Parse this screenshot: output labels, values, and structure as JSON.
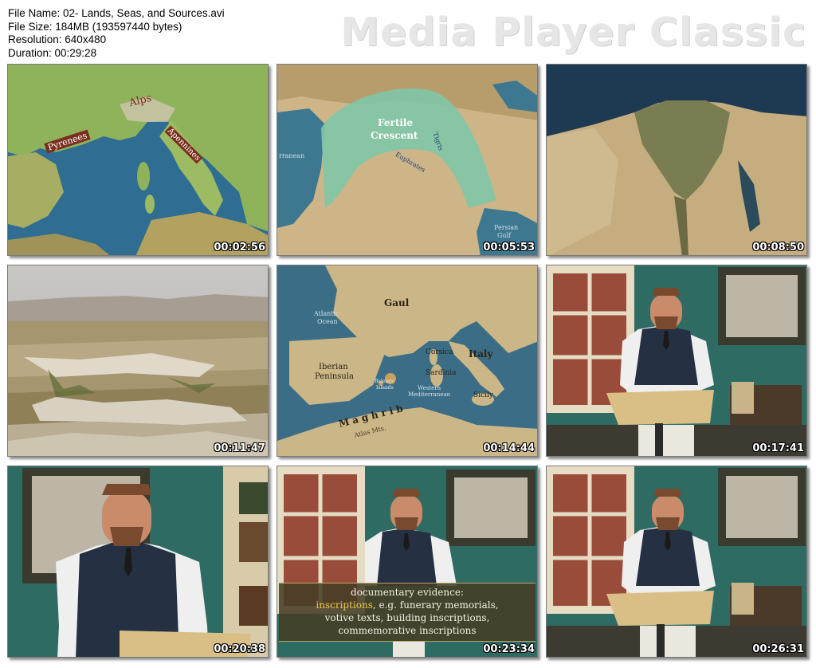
{
  "file_info": {
    "name": "File Name: 02- Lands, Seas, and Sources.avi",
    "size": "File Size: 184MB (193597440 bytes)",
    "resolution": "Resolution: 640x480",
    "duration": "Duration: 00:29:28"
  },
  "brand": "Media Player Classic",
  "thumbnails": [
    {
      "time": "00:02:56",
      "labels": {
        "alps": "Alps",
        "pyrenees": "Pyrenees",
        "apennines": "Apennines"
      }
    },
    {
      "time": "00:05:53",
      "labels": {
        "fertile": "Fertile",
        "crescent": "Crescent",
        "tigris": "Tigris",
        "euphrates": "Euphrates",
        "persian": "Persian",
        "gulf": "Gulf",
        "mediterranean": "rranean"
      }
    },
    {
      "time": "00:08:50"
    },
    {
      "time": "00:11:47"
    },
    {
      "time": "00:14:44",
      "labels": {
        "gaul": "Gaul",
        "atlantic": "Atlantic",
        "ocean": "Ocean",
        "iberian": "Iberian",
        "peninsula": "Peninsula",
        "italy": "Italy",
        "corsica": "Corsica",
        "sardinia": "Sardinia",
        "sicily": "Sicily",
        "balearic": "Balearic",
        "islands": "Islands",
        "western": "Western",
        "western_med": "Mediterranean",
        "maghrib": "M a g h r i b",
        "atlas": "Atlas Mts."
      }
    },
    {
      "time": "00:17:41"
    },
    {
      "time": "00:20:38"
    },
    {
      "time": "00:23:34",
      "caption": {
        "line1": "documentary evidence:",
        "highlight": "inscriptions",
        "line2_rest": ", e.g. funerary memorials,",
        "line3": "votive texts, building inscriptions,",
        "line4": "commemorative inscriptions"
      }
    },
    {
      "time": "00:26:31"
    }
  ]
}
